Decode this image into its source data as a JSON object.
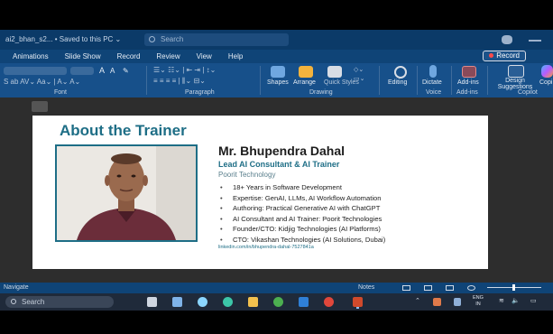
{
  "window": {
    "file_name": "ai2_bhan_s2... • Saved to this PC ⌄",
    "search_placeholder": "Search"
  },
  "ribbon": {
    "tabs": [
      "Animations",
      "Slide Show",
      "Record",
      "Review",
      "View",
      "Help"
    ],
    "record_button": "Record",
    "groups": {
      "font": "Font",
      "paragraph": "Paragraph",
      "drawing": "Drawing",
      "voice": "Voice",
      "addins": "Add-ins",
      "copilot": "Copilot"
    },
    "buttons": {
      "shapes": "Shapes",
      "arrange": "Arrange",
      "quick_styles": "Quick Styles",
      "editing": "Editing",
      "dictate": "Dictate",
      "add_ins": "Add-ins",
      "design_suggestions": "Design Suggestions",
      "copilot": "Copi"
    }
  },
  "slide": {
    "title": "About the Trainer",
    "name": "Mr. Bhupendra Dahal",
    "role": "Lead AI Consultant & AI Trainer",
    "org": "Poorit Technology",
    "bullets": [
      "18+ Years in Software Development",
      "Expertise: GenAI, LLMs, AI Workflow Automation",
      "Authoring: Practical Generative AI with ChatGPT",
      "AI Consultant and AI Trainer: Poorit Technologies",
      "Founder/CTO: Kidjig Technologies (AI Platforms)",
      "CTO: Vikashan Technologies (AI Solutions, Dubai)"
    ],
    "link": "linkedin.com/in/bhupendra-dahal-7527841a"
  },
  "statusbar": {
    "left": "Navigate",
    "notes": "Notes"
  },
  "taskbar": {
    "search_placeholder": "Search",
    "lang_line1": "ENG",
    "lang_line2": "IN"
  },
  "colors": {
    "accent": "#1e6e86",
    "ribbon": "#17508a",
    "titlebar": "#0b3a68"
  }
}
